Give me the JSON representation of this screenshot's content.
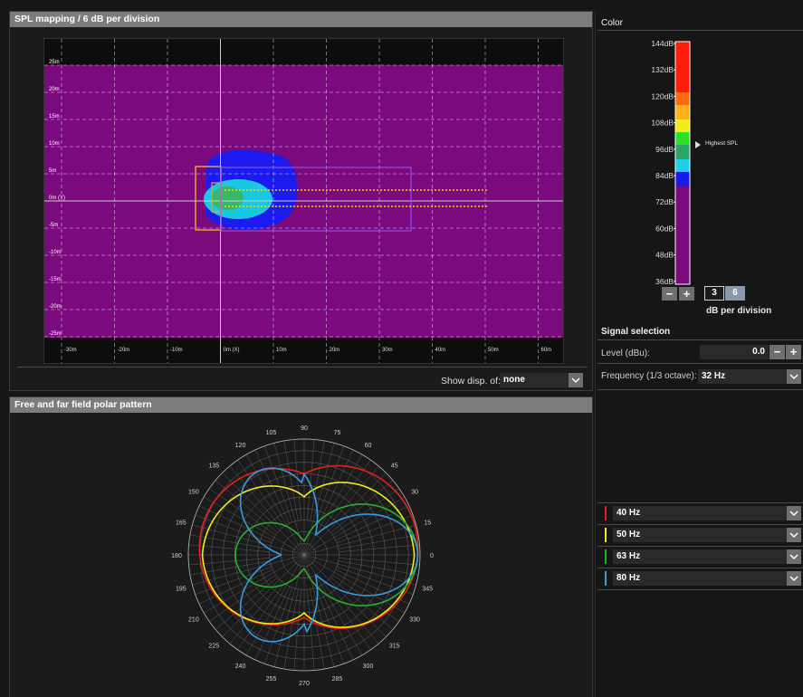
{
  "spl_panel": {
    "title": "SPL mapping / 6 dB per division",
    "show_disp_label": "Show disp. of:",
    "show_disp_value": "none"
  },
  "spl_map": {
    "y_ticks": [
      "25m",
      "20m",
      "15m",
      "10m",
      "5m",
      "0m (Y)",
      "-5m",
      "-10m",
      "-15m",
      "-20m",
      "-25m"
    ],
    "x_ticks": [
      "-30m",
      "-20m",
      "-10m",
      "0m (X)",
      "10m",
      "20m",
      "30m",
      "40m",
      "50m",
      "60m"
    ],
    "colors": {
      "background": "#7a0a7e",
      "blue": "#1b1bf0",
      "cyan": "#18c8e0",
      "green": "#35b86a",
      "line": "#ffd400"
    }
  },
  "polar_panel": {
    "title": "Free and far field polar pattern",
    "angle_labels": [
      "0",
      "15",
      "30",
      "45",
      "60",
      "75",
      "90",
      "105",
      "120",
      "135",
      "150",
      "165",
      "180",
      "195",
      "210",
      "225",
      "240",
      "255",
      "270",
      "285",
      "300",
      "315",
      "330",
      "345"
    ]
  },
  "color_panel": {
    "title": "Color",
    "scale_labels": [
      "144dB",
      "132dB",
      "120dB",
      "108dB",
      "96dB",
      "84dB",
      "72dB",
      "60dB",
      "48dB",
      "36dB"
    ],
    "highest_spl_label": "Highest SPL",
    "minus_label": "−",
    "plus_label": "+",
    "division_options": [
      "3",
      "6"
    ],
    "division_selected": "6",
    "division_caption": "dB per division"
  },
  "signal_selection": {
    "title": "Signal selection",
    "level_label": "Level (dBu):",
    "level_value": "0.0",
    "minus_label": "−",
    "plus_label": "+",
    "frequency_label": "Frequency (1/3 octave):",
    "frequency_value": "32 Hz"
  },
  "polar_series": [
    {
      "label": "40 Hz",
      "color": "#e8211d"
    },
    {
      "label": "50 Hz",
      "color": "#f2ec1a"
    },
    {
      "label": "63 Hz",
      "color": "#28b02a"
    },
    {
      "label": "80 Hz",
      "color": "#3a9ae0"
    }
  ]
}
